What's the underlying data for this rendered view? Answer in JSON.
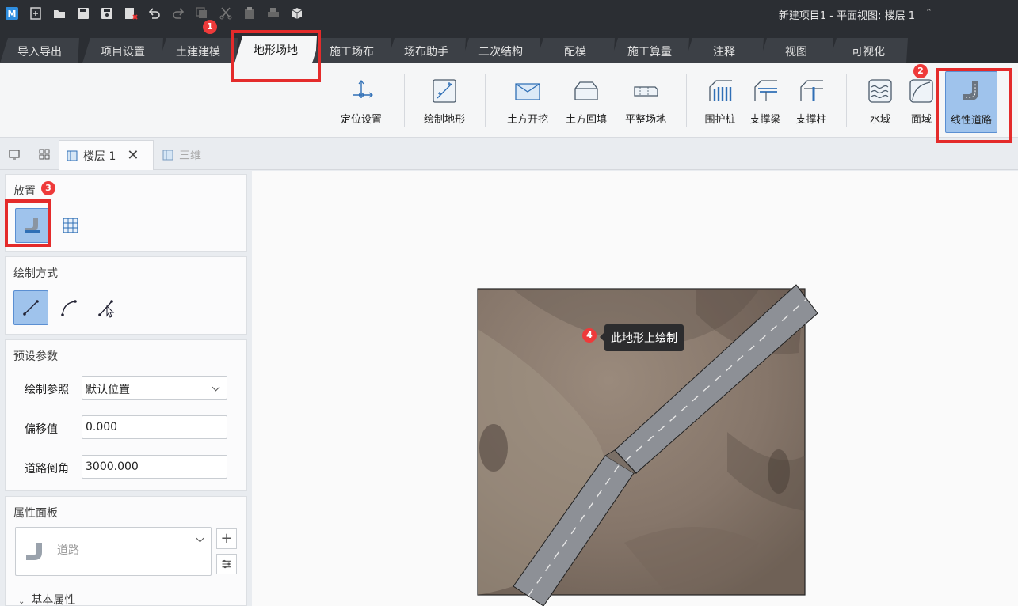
{
  "window": {
    "title": "新建项目1 - 平面视图: 楼层 1",
    "app_logo": "M"
  },
  "quick_access": {
    "icons": [
      "new-file-icon",
      "open-folder-icon",
      "save-icon",
      "save-as-icon",
      "close-file-icon",
      "undo-icon",
      "redo-icon",
      "copy-icon",
      "cut-icon",
      "paste-icon",
      "print-icon",
      "3d-box-icon"
    ]
  },
  "tabs": [
    {
      "label": "导入导出"
    },
    {
      "label": "项目设置"
    },
    {
      "label": "土建建模"
    },
    {
      "label": "地形场地",
      "active": true
    },
    {
      "label": "施工场布"
    },
    {
      "label": "场布助手"
    },
    {
      "label": "二次结构"
    },
    {
      "label": "配模"
    },
    {
      "label": "施工算量"
    },
    {
      "label": "注释"
    },
    {
      "label": "视图"
    },
    {
      "label": "可视化"
    }
  ],
  "ribbon": {
    "buttons": [
      {
        "label": "定位设置",
        "icon": "axis-origin-icon"
      },
      {
        "label": "绘制地形",
        "icon": "terrain-draw-icon"
      },
      {
        "label": "土方开挖",
        "icon": "excavation-icon"
      },
      {
        "label": "土方回填",
        "icon": "backfill-icon"
      },
      {
        "label": "平整场地",
        "icon": "level-site-icon"
      },
      {
        "label": "围护桩",
        "icon": "retaining-pile-icon"
      },
      {
        "label": "支撑梁",
        "icon": "support-beam-icon"
      },
      {
        "label": "支撑柱",
        "icon": "support-column-icon"
      },
      {
        "label": "水域",
        "icon": "water-icon"
      },
      {
        "label": "面域",
        "icon": "region-icon"
      },
      {
        "label": "线性道路",
        "icon": "linear-road-icon",
        "selected": true
      }
    ]
  },
  "doc_tabs": [
    {
      "label": "楼层 1",
      "active": true
    },
    {
      "label": "三维",
      "active": false
    }
  ],
  "panel": {
    "placement": {
      "title": "放置",
      "buttons": [
        "road-place-icon",
        "grid-place-icon"
      ]
    },
    "draw_mode": {
      "title": "绘制方式",
      "buttons": [
        "line-tool-icon",
        "arc-tool-icon",
        "pick-line-icon"
      ]
    },
    "preset": {
      "title": "预设参数",
      "draw_ref_label": "绘制参照",
      "draw_ref_value": "默认位置",
      "offset_label": "偏移值",
      "offset_value": "0.000",
      "fillet_label": "道路倒角",
      "fillet_value": "3000.000"
    },
    "properties": {
      "title": "属性面板",
      "type_value": "道路",
      "basic_label": "基本属性"
    }
  },
  "canvas": {
    "tooltip": "此地形上绘制"
  },
  "annotations": {
    "b1": "1",
    "b2": "2",
    "b3": "3",
    "b4": "4"
  },
  "colors": {
    "highlight": "#e42b2b",
    "selected_bg": "#9fc3ec",
    "dark_bar": "#2b2e33"
  }
}
